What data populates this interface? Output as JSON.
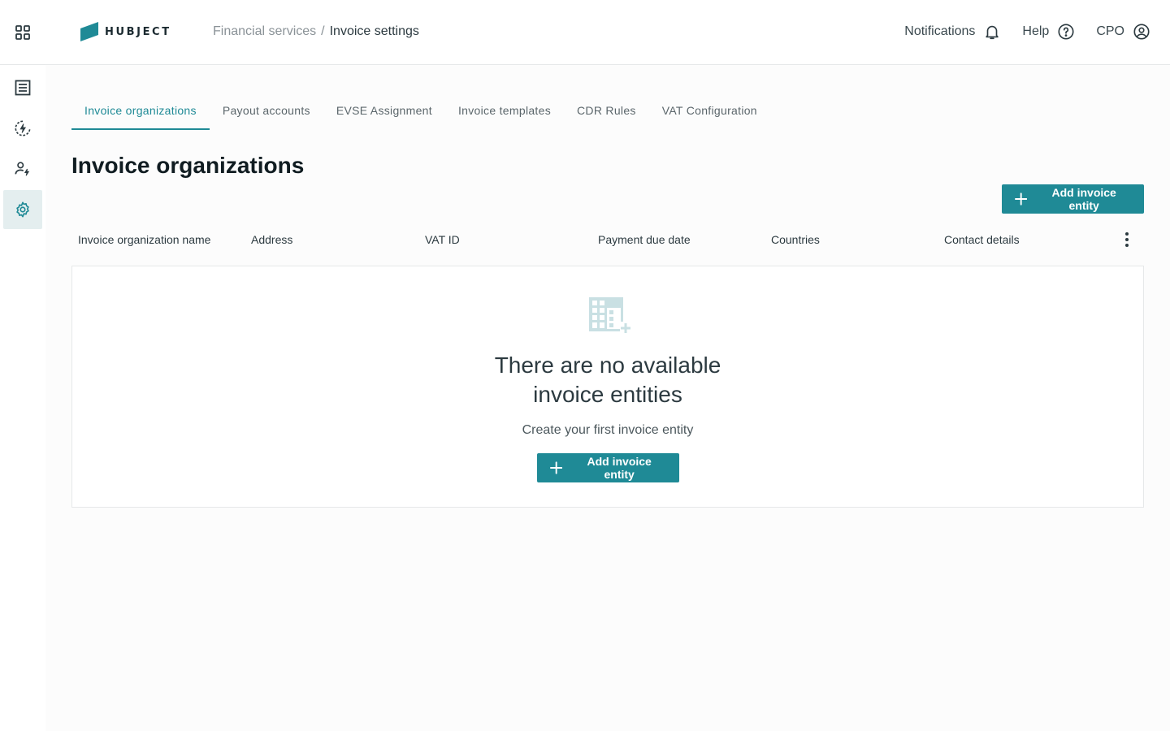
{
  "header": {
    "logo_text": "HUBJECT",
    "breadcrumb": {
      "parent": "Financial services",
      "separator": "/",
      "current": "Invoice settings"
    },
    "notifications_label": "Notifications",
    "help_label": "Help",
    "user_label": "CPO"
  },
  "sidebar": {
    "items": [
      {
        "icon": "list-icon"
      },
      {
        "icon": "charging-icon"
      },
      {
        "icon": "user-charging-icon"
      },
      {
        "icon": "gear-icon",
        "active": true
      }
    ]
  },
  "tabs": [
    {
      "label": "Invoice organizations",
      "active": true
    },
    {
      "label": "Payout accounts"
    },
    {
      "label": "EVSE Assignment"
    },
    {
      "label": "Invoice templates"
    },
    {
      "label": "CDR Rules"
    },
    {
      "label": "VAT Configuration"
    }
  ],
  "main": {
    "title": "Invoice organizations",
    "add_button_label": "Add invoice entity",
    "columns": [
      "Invoice organization name",
      "Address",
      "VAT ID",
      "Payment due date",
      "Countries",
      "Contact details"
    ],
    "empty_state": {
      "title_line1": "There are no available",
      "title_line2": "invoice entities",
      "subtitle": "Create your first invoice entity",
      "button_label": "Add invoice entity"
    }
  },
  "colors": {
    "accent": "#1f8a96",
    "active_bg": "#e4eeef",
    "icon_light": "#c9e0e3"
  }
}
